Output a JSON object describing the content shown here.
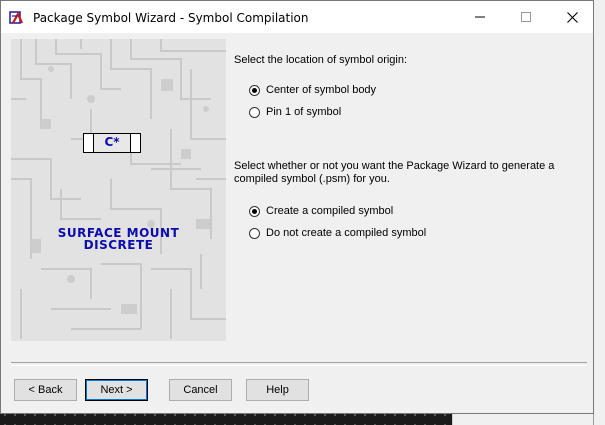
{
  "window": {
    "title": "Package Symbol Wizard - Symbol Compilation",
    "minimize_glyph": "—",
    "maximize_glyph": "☐",
    "close_glyph": "✕"
  },
  "side_panel": {
    "chip_label": "C*",
    "title_line1": "SURFACE MOUNT",
    "title_line2": "DISCRETE"
  },
  "origin_section": {
    "prompt": "Select the location of symbol origin:",
    "options": [
      {
        "label": "Center of symbol body",
        "checked": true
      },
      {
        "label": "Pin 1 of symbol",
        "checked": false
      }
    ]
  },
  "compile_section": {
    "prompt_line1": "Select whether or not you want the Package Wizard to generate a",
    "prompt_line2": "compiled symbol (.psm) for you.",
    "options": [
      {
        "label": "Create a compiled symbol",
        "checked": true
      },
      {
        "label": "Do not create a compiled symbol",
        "checked": false
      }
    ]
  },
  "buttons": {
    "back": "< Back",
    "next": "Next >",
    "cancel": "Cancel",
    "help": "Help"
  },
  "colors": {
    "accent_blue": "#0b0bb0",
    "dialog_bg": "#f0f0f0"
  }
}
